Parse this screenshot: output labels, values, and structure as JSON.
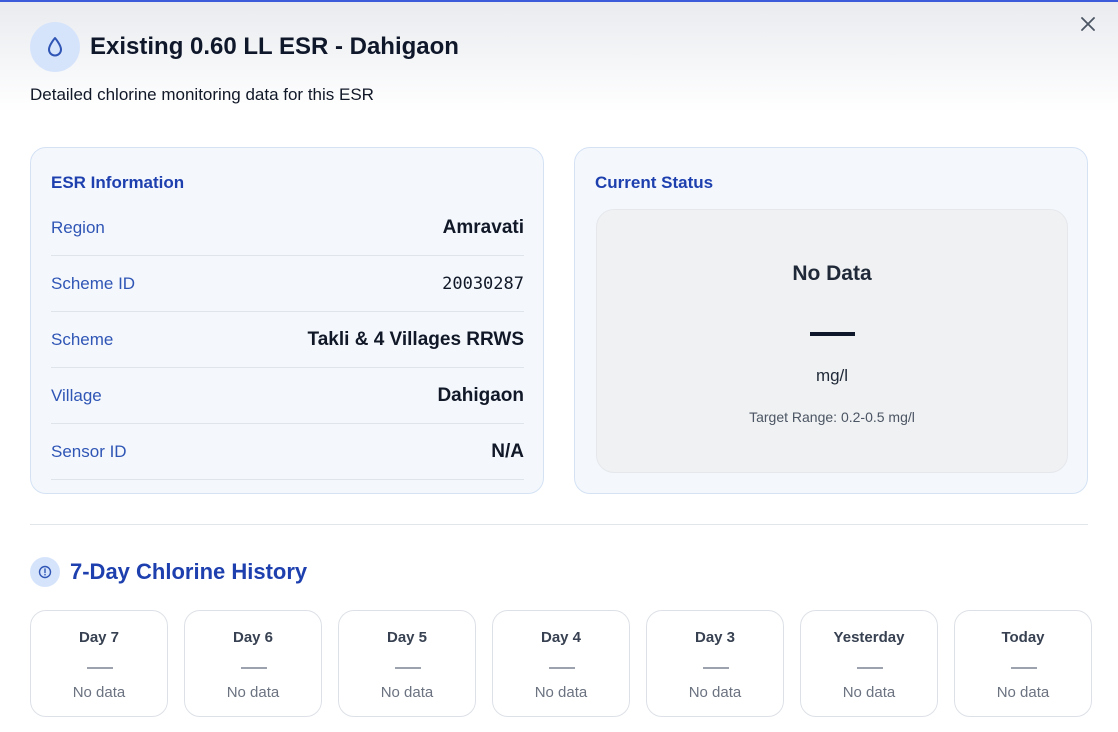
{
  "modal": {
    "title": "Existing 0.60 LL ESR - Dahigaon",
    "subtitle": "Detailed chlorine monitoring data for this ESR",
    "close_icon": "close-icon",
    "header_icon": "droplet-icon"
  },
  "info": {
    "title": "ESR Information",
    "rows": [
      {
        "label": "Region",
        "value": "Amravati"
      },
      {
        "label": "Scheme ID",
        "value": "20030287"
      },
      {
        "label": "Scheme",
        "value": "Takli & 4 Villages RRWS"
      },
      {
        "label": "Village",
        "value": "Dahigaon"
      },
      {
        "label": "Sensor ID",
        "value": "N/A"
      }
    ]
  },
  "status": {
    "title": "Current Status",
    "text": "No Data",
    "unit": "mg/l",
    "target": "Target Range: 0.2-0.5 mg/l"
  },
  "history": {
    "title": "7-Day Chlorine History",
    "icon": "alert-circle-icon",
    "days": [
      {
        "label": "Day 7",
        "value": "No data"
      },
      {
        "label": "Day 6",
        "value": "No data"
      },
      {
        "label": "Day 5",
        "value": "No data"
      },
      {
        "label": "Day 4",
        "value": "No data"
      },
      {
        "label": "Day 3",
        "value": "No data"
      },
      {
        "label": "Yesterday",
        "value": "No data"
      },
      {
        "label": "Today",
        "value": "No data"
      }
    ]
  },
  "colors": {
    "accent": "#1e40af",
    "label": "#2f55b5",
    "card_bg": "#f4f8fd",
    "icon_bg": "#d6e4fb"
  }
}
